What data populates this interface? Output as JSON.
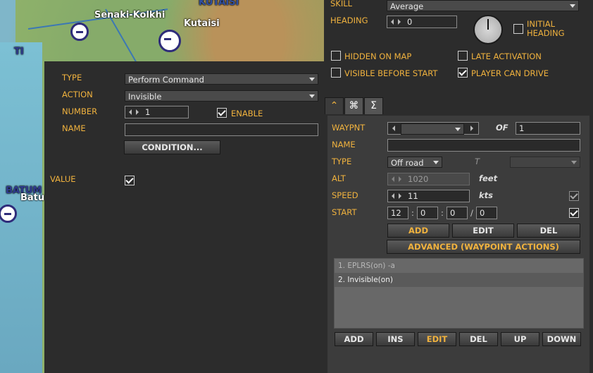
{
  "map": {
    "cities": [
      "Senaki-Kolkhi",
      "Kutaisi",
      "KUTAISI",
      "BATUM",
      "Batu",
      "TI"
    ]
  },
  "trigger": {
    "type_label": "TYPE",
    "type_value": "Perform Command",
    "action_label": "ACTION",
    "action_value": "Invisible",
    "number_label": "NUMBER",
    "number_value": "1",
    "enable_label": "ENABLE",
    "enable_checked": true,
    "name_label": "NAME",
    "name_value": "",
    "condition_button": "CONDITION...",
    "value_label": "VALUE",
    "value_checked": true
  },
  "unit": {
    "skill_label": "SKILL",
    "skill_value": "Average",
    "heading_label": "HEADING",
    "heading_value": "0",
    "initial_heading_label": "INITIAL HEADING",
    "initial_heading_checked": false,
    "hidden_on_map_label": "HIDDEN ON MAP",
    "hidden_on_map_checked": false,
    "late_activation_label": "LATE ACTIVATION",
    "late_activation_checked": false,
    "visible_before_start_label": "VISIBLE BEFORE START",
    "visible_before_start_checked": false,
    "player_can_drive_label": "PLAYER CAN DRIVE",
    "player_can_drive_checked": true
  },
  "tabs": [
    {
      "icon": "route-icon",
      "glyph": "⌃",
      "active": true
    },
    {
      "icon": "command-icon",
      "glyph": "⌘",
      "active": false
    },
    {
      "icon": "summary-icon",
      "glyph": "Σ",
      "active": false
    }
  ],
  "waypoint": {
    "waypnt_label": "WAYPNT",
    "waypnt_value": "",
    "of_label": "OF",
    "of_value": "1",
    "name_label": "NAME",
    "name_value": "",
    "type_label": "TYPE",
    "type_value": "Off road",
    "type_t_label": "T",
    "alt_label": "ALT",
    "alt_value": "1020",
    "alt_units": "feet",
    "speed_label": "SPEED",
    "speed_value": "11",
    "speed_units": "kts",
    "start_label": "START",
    "start_h": "12",
    "start_m": "0",
    "start_s": "0",
    "start_d": "0",
    "add_button": "ADD",
    "edit_button": "EDIT",
    "del_button": "DEL",
    "advanced_button": "ADVANCED (WAYPOINT ACTIONS)",
    "actions": [
      "1. EPLRS(on) -a",
      "2. Invisible(on)"
    ],
    "list_buttons": [
      "ADD",
      "INS",
      "EDIT",
      "DEL",
      "UP",
      "DOWN"
    ]
  }
}
